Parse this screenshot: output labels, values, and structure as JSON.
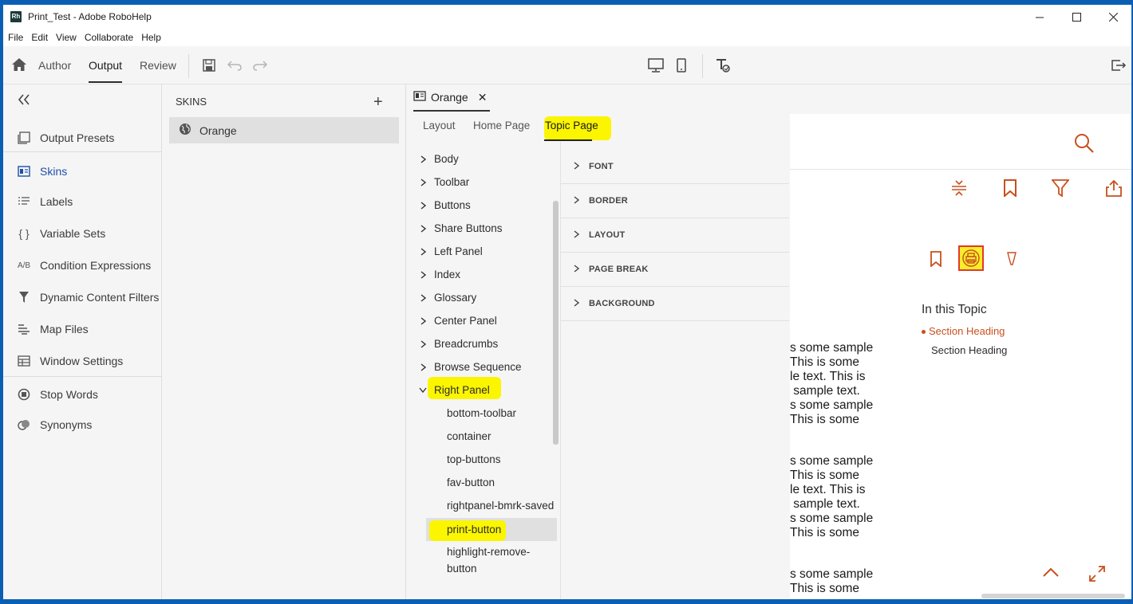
{
  "window": {
    "title": "Print_Test - Adobe RoboHelp",
    "logo_text": "Rh"
  },
  "menu": [
    "File",
    "Edit",
    "View",
    "Collaborate",
    "Help"
  ],
  "toolbar": {
    "tabs": [
      {
        "label": "Author",
        "active": false
      },
      {
        "label": "Output",
        "active": true
      },
      {
        "label": "Review",
        "active": false
      }
    ]
  },
  "leftnav": {
    "items": [
      {
        "label": "Output Presets",
        "icon": "output-presets-icon"
      },
      {
        "label": "Skins",
        "icon": "skins-icon",
        "selected": true
      },
      {
        "label": "Labels",
        "icon": "labels-icon"
      },
      {
        "label": "Variable Sets",
        "icon": "variable-sets-icon",
        "glyph": "{ }"
      },
      {
        "label": "Condition Expressions",
        "icon": "condition-expressions-icon",
        "glyph": "A/B"
      },
      {
        "label": "Dynamic Content Filters",
        "icon": "filter-icon"
      },
      {
        "label": "Map Files",
        "icon": "map-files-icon"
      },
      {
        "label": "Window Settings",
        "icon": "window-settings-icon"
      },
      {
        "label": "Stop Words",
        "icon": "stop-words-icon"
      },
      {
        "label": "Synonyms",
        "icon": "synonyms-icon"
      }
    ]
  },
  "skins_panel": {
    "title": "SKINS",
    "add_label": "+",
    "items": [
      {
        "label": "Orange"
      }
    ]
  },
  "editor": {
    "doc_tab": {
      "label": "Orange",
      "close": "✕"
    },
    "sub_tabs": [
      {
        "label": "Layout",
        "active": false
      },
      {
        "label": "Home Page",
        "active": false
      },
      {
        "label": "Topic Page",
        "active": true
      }
    ],
    "tree": [
      {
        "label": "Body"
      },
      {
        "label": "Toolbar"
      },
      {
        "label": "Buttons"
      },
      {
        "label": "Share Buttons"
      },
      {
        "label": "Left Panel"
      },
      {
        "label": "Index"
      },
      {
        "label": "Glossary"
      },
      {
        "label": "Center Panel"
      },
      {
        "label": "Breadcrumbs"
      },
      {
        "label": "Browse Sequence"
      },
      {
        "label": "Right Panel",
        "expanded": true
      }
    ],
    "tree_children": [
      {
        "label": "bottom-toolbar"
      },
      {
        "label": "container"
      },
      {
        "label": "top-buttons"
      },
      {
        "label": "fav-button"
      },
      {
        "label": "rightpanel-bmrk-saved"
      },
      {
        "label": "print-button",
        "selected": true
      },
      {
        "label": "highlight-remove-\nbutton"
      }
    ],
    "properties": [
      "FONT",
      "BORDER",
      "LAYOUT",
      "PAGE BREAK",
      "BACKGROUND"
    ]
  },
  "preview": {
    "accent": "#c8501e",
    "text_blocks": [
      "s some sample\nThis is some\nle text. This is\n sample text.\ns some sample\nThis is some",
      "s some sample\nThis is some\nle text. This is\n sample text.\ns some sample\nThis is some",
      "s some sample\nThis is some"
    ],
    "toc": {
      "title": "In this Topic",
      "items": [
        {
          "label": "Section Heading",
          "active": true
        },
        {
          "label": "Section Heading",
          "active": false
        }
      ]
    }
  },
  "colors": {
    "highlight": "#fbf500",
    "selected_nav": "#1e4fa8",
    "preview_accent": "#c8501e"
  }
}
